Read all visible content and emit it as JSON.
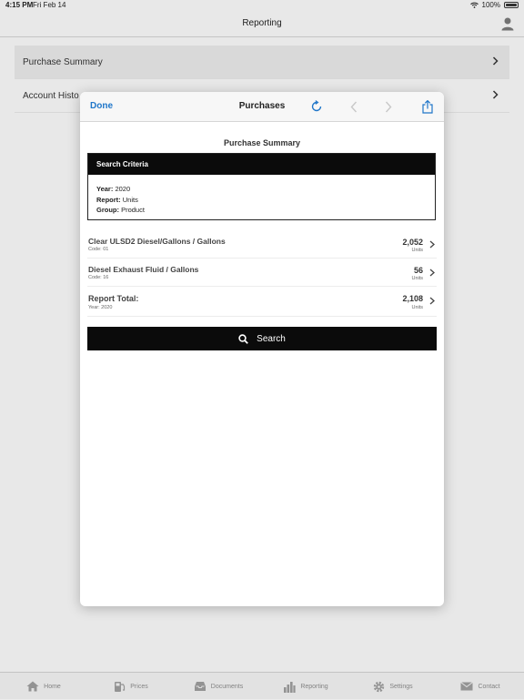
{
  "status": {
    "time": "4:15 PM",
    "date": "Fri Feb 14",
    "battery": "100%"
  },
  "nav": {
    "title": "Reporting"
  },
  "list": {
    "items": [
      {
        "label": "Purchase Summary"
      },
      {
        "label": "Account Histo"
      }
    ]
  },
  "modal": {
    "done": "Done",
    "title": "Purchases",
    "report_title": "Purchase Summary",
    "criteria": {
      "header": "Search Criteria",
      "year_label": "Year:",
      "year": "2020",
      "report_label": "Report:",
      "report": "Units",
      "group_label": "Group:",
      "group": "Product"
    },
    "rows": [
      {
        "name": "Clear ULSD2 Diesel/Gallons / Gallons",
        "code": "Code: 01",
        "value": "2,052",
        "unit": "Units"
      },
      {
        "name": "Diesel Exhaust Fluid / Gallons",
        "code": "Code: 16",
        "value": "56",
        "unit": "Units"
      }
    ],
    "total": {
      "name": "Report Total:",
      "sub": "Year: 2020",
      "value": "2,108",
      "unit": "Units"
    },
    "search_label": "Search"
  },
  "tabs": [
    {
      "label": "Home",
      "icon": "home-icon"
    },
    {
      "label": "Prices",
      "icon": "fuel-pump-icon"
    },
    {
      "label": "Documents",
      "icon": "inbox-icon"
    },
    {
      "label": "Reporting",
      "icon": "bar-chart-icon"
    },
    {
      "label": "Settings",
      "icon": "gear-icon"
    },
    {
      "label": "Contact",
      "icon": "envelope-icon"
    }
  ],
  "colors": {
    "accent": "#1f76c9",
    "header_black": "#0b0b0b"
  }
}
